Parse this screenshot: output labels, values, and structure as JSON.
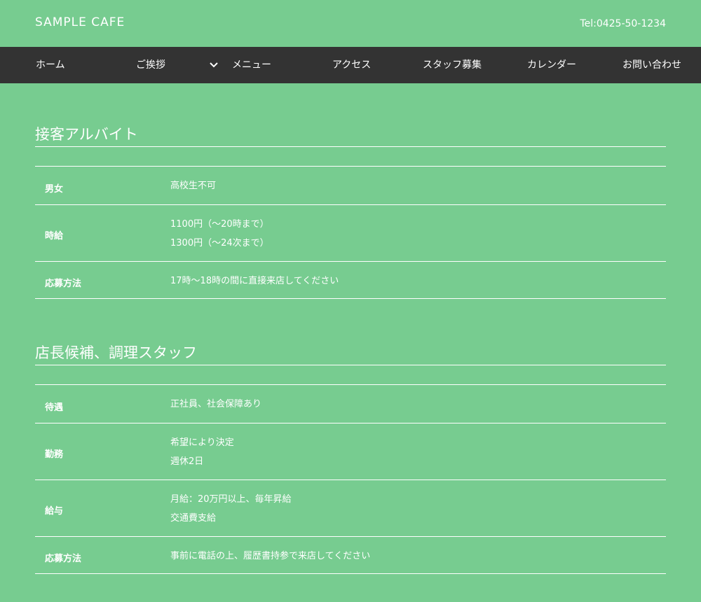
{
  "header": {
    "logo": "SAMPLE CAFE",
    "tel": "Tel:0425-50-1234"
  },
  "nav": {
    "items": [
      {
        "label": "ホーム"
      },
      {
        "label": "ご挨拶"
      },
      {
        "label": "メニュー"
      },
      {
        "label": "アクセス"
      },
      {
        "label": "スタッフ募集"
      },
      {
        "label": "カレンダー"
      },
      {
        "label": "お問い合わせ"
      }
    ],
    "dropdown_icon": "chevron-down-icon"
  },
  "sections": [
    {
      "title": "接客アルバイト",
      "rows": [
        {
          "label": "男女",
          "lines": [
            "高校生不可"
          ]
        },
        {
          "label": "時給",
          "lines": [
            "1100円（～20時まで）",
            "1300円（～24次まで）"
          ]
        },
        {
          "label": "応募方法",
          "lines": [
            "17時～18時の間に直接来店してください"
          ]
        }
      ]
    },
    {
      "title": "店長候補、調理スタッフ",
      "rows": [
        {
          "label": "待遇",
          "lines": [
            "正社員、社会保障あり"
          ]
        },
        {
          "label": "勤務",
          "lines": [
            "希望により決定",
            "週休2日"
          ]
        },
        {
          "label": "給与",
          "lines": [
            "月給：20万円以上、毎年昇給",
            "交通費支給"
          ]
        },
        {
          "label": "応募方法",
          "lines": [
            "事前に電話の上、履歴書持参で来店してください"
          ]
        }
      ]
    }
  ],
  "colors": {
    "background": "#77cc90",
    "nav_background": "#333333",
    "text": "#ffffff"
  }
}
